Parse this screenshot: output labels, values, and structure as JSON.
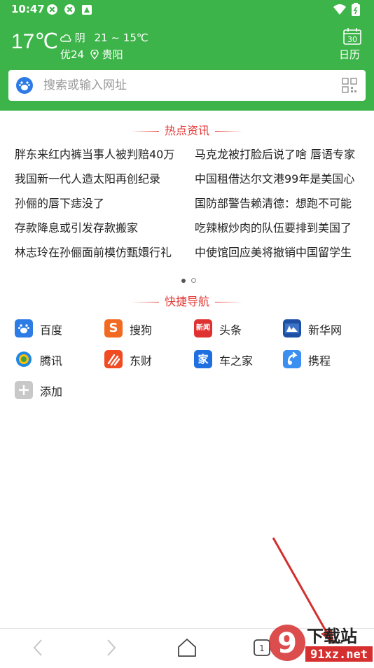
{
  "status_bar": {
    "time": "10:47"
  },
  "weather": {
    "temperature": "17℃",
    "condition": "阴",
    "range": "21 ~ 15℃",
    "air_quality": "优24",
    "city": "贵阳"
  },
  "calendar": {
    "day": "30",
    "label": "日历"
  },
  "search": {
    "placeholder": "搜索或输入网址"
  },
  "hot_news": {
    "title": "热点资讯",
    "items": [
      "胖东来红内裤当事人被判赔40万",
      "马克龙被打脸后说了啥 唇语专家",
      "我国新一代人造太阳再创纪录",
      "中国租借达尔文港99年是美国心",
      "孙俪的唇下痣没了",
      "国防部警告赖清德：想跑不可能",
      "存款降息或引发存款搬家",
      "吃辣椒炒肉的队伍要排到美国了",
      "林志玲在孙俪面前模仿甄嬛行礼",
      "中使馆回应美将撤销中国留学生"
    ],
    "page_count": 2,
    "active_page": 0
  },
  "quick_nav": {
    "title": "快捷导航",
    "items": [
      {
        "label": "百度",
        "icon": "baidu-icon"
      },
      {
        "label": "搜狗",
        "icon": "sogou-icon",
        "glyph": "S"
      },
      {
        "label": "头条",
        "icon": "toutiao-icon",
        "glyph": "新闻"
      },
      {
        "label": "新华网",
        "icon": "xinhua-icon"
      },
      {
        "label": "腾讯",
        "icon": "tencent-icon"
      },
      {
        "label": "东财",
        "icon": "dongcai-icon"
      },
      {
        "label": "车之家",
        "icon": "autohome-icon",
        "glyph": "家"
      },
      {
        "label": "携程",
        "icon": "ctrip-icon"
      },
      {
        "label": "添加",
        "icon": "add-icon"
      }
    ]
  },
  "bottom_bar": {
    "tab_count": "1"
  },
  "watermark": {
    "brand": "下载站",
    "domain": "91xz.net",
    "mark": "9"
  },
  "colors": {
    "primary_green": "#3cb449",
    "accent_red": "#e53935"
  }
}
